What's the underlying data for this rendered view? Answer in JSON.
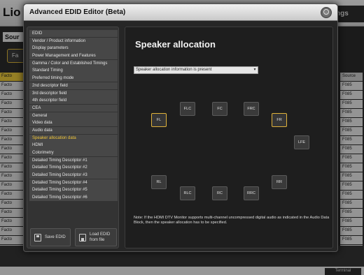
{
  "background": {
    "logo": "Lio",
    "tab_right": "ngs",
    "sources_label": "Sour",
    "factory_button": "Fa",
    "left_rows": [
      "Facto",
      "Facto",
      "Facto",
      "Facto",
      "Facto",
      "Facto",
      "Facto",
      "Facto",
      "Facto",
      "Facto",
      "Facto",
      "Facto",
      "Facto",
      "Facto",
      "Facto",
      "Facto",
      "Facto",
      "Facto",
      "Facto",
      "Facto"
    ],
    "source_header": "Source",
    "right_rows": [
      "F085",
      "F085",
      "F085",
      "F085",
      "F085",
      "F085",
      "F085",
      "F085",
      "F085",
      "F085",
      "F085",
      "F085",
      "F085",
      "F085",
      "F085",
      "F085",
      "F085",
      "F085",
      "F085",
      "F085"
    ],
    "terminal_button": "Terminal"
  },
  "modal": {
    "title": "Advanced EDID Editor (Beta)"
  },
  "menu": {
    "items": [
      {
        "label": "EDID",
        "active": false
      },
      {
        "label": "Vendor / Product information",
        "active": false
      },
      {
        "label": "Display parameters",
        "active": false
      },
      {
        "label": "Power Management and Features",
        "active": false
      },
      {
        "label": "Gamma / Color and Established Timings",
        "active": false
      },
      {
        "label": "Standard Timing",
        "active": false
      },
      {
        "label": "Preferred timing mode",
        "active": false
      },
      {
        "label": "2nd descriptor field",
        "active": false
      },
      {
        "label": "3rd descriptor field",
        "active": false
      },
      {
        "label": "4th descriptor field",
        "active": false
      },
      {
        "label": "CEA",
        "active": false
      },
      {
        "label": "General",
        "active": false
      },
      {
        "label": "Video data",
        "active": false
      },
      {
        "label": "Audio data",
        "active": false
      },
      {
        "label": "Speaker allocation data",
        "active": true
      },
      {
        "label": "HDMI",
        "active": false
      },
      {
        "label": "Colorimetry",
        "active": false
      },
      {
        "label": "Detailed Timing Descriptor #1",
        "active": false
      },
      {
        "label": "Detailed Timing Descriptor #2",
        "active": false
      },
      {
        "label": "Detailed Timing Descriptor #3",
        "active": false
      },
      {
        "label": "Detailed Timing Descriptor #4",
        "active": false
      },
      {
        "label": "Detailed Timing Descriptor #5",
        "active": false
      },
      {
        "label": "Detailed Timing Descriptor #6",
        "active": false
      }
    ],
    "save_label": "Save EDID",
    "load_label": "Load EDID from file"
  },
  "content": {
    "title": "Speaker allocation",
    "select_value": "Speaker allocation information is present",
    "select_arrow": "▾",
    "speakers": {
      "FL": "FL",
      "FLC": "FLC",
      "FC": "FC",
      "FRC": "FRC",
      "FR": "FR",
      "LFE": "LFE",
      "RL": "RL",
      "RLC": "RLC",
      "RC": "RC",
      "RRC": "RRC",
      "RR": "RR"
    },
    "speakers_on": [
      "FL",
      "FR"
    ],
    "note": "Note: If the HDMI DTV Monitor supports multi-channel uncompressed digital audio as indicated in the Audio Data Block, then the speaker allocation has to be specified."
  },
  "colors": {
    "accent": "#f0c63a",
    "active_speaker_border": "#e0b23a"
  },
  "icons": {
    "close": "close-icon",
    "save": "save-icon",
    "load": "load-icon"
  }
}
